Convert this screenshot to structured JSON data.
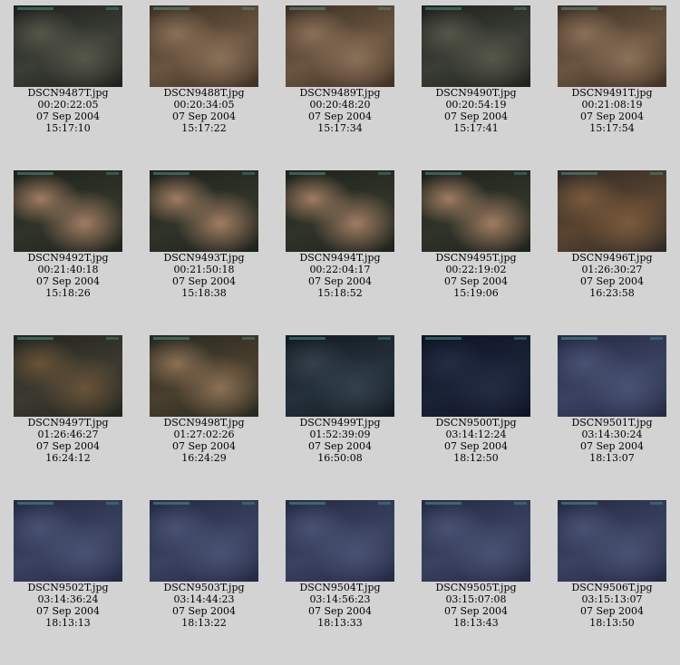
{
  "thumbnails": [
    {
      "file": "DSCN9487T.jpg",
      "timecode": "00:20:22:05",
      "date": "07 Sep 2004",
      "time": "15:17:10",
      "tone": "dark-rock"
    },
    {
      "file": "DSCN9488T.jpg",
      "timecode": "00:20:34:05",
      "date": "07 Sep 2004",
      "time": "15:17:22",
      "tone": "brown-rock"
    },
    {
      "file": "DSCN9489T.jpg",
      "timecode": "00:20:48:20",
      "date": "07 Sep 2004",
      "time": "15:17:34",
      "tone": "brown-rock"
    },
    {
      "file": "DSCN9490T.jpg",
      "timecode": "00:20:54:19",
      "date": "07 Sep 2004",
      "time": "15:17:41",
      "tone": "dark-rock"
    },
    {
      "file": "DSCN9491T.jpg",
      "timecode": "00:21:08:19",
      "date": "07 Sep 2004",
      "time": "15:17:54",
      "tone": "brown-rock"
    },
    {
      "file": "DSCN9492T.jpg",
      "timecode": "00:21:40:18",
      "date": "07 Sep 2004",
      "time": "15:18:26",
      "tone": "pillow"
    },
    {
      "file": "DSCN9493T.jpg",
      "timecode": "00:21:50:18",
      "date": "07 Sep 2004",
      "time": "15:18:38",
      "tone": "pillow"
    },
    {
      "file": "DSCN9494T.jpg",
      "timecode": "00:22:04:17",
      "date": "07 Sep 2004",
      "time": "15:18:52",
      "tone": "pillow"
    },
    {
      "file": "DSCN9495T.jpg",
      "timecode": "00:22:19:02",
      "date": "07 Sep 2004",
      "time": "15:19:06",
      "tone": "pillow"
    },
    {
      "file": "DSCN9496T.jpg",
      "timecode": "01:26:30:27",
      "date": "07 Sep 2004",
      "time": "16:23:58",
      "tone": "sediment"
    },
    {
      "file": "DSCN9497T.jpg",
      "timecode": "01:26:46:27",
      "date": "07 Sep 2004",
      "time": "16:24:12",
      "tone": "sediment-dark"
    },
    {
      "file": "DSCN9498T.jpg",
      "timecode": "01:27:02:26",
      "date": "07 Sep 2004",
      "time": "16:24:29",
      "tone": "pillow-dark"
    },
    {
      "file": "DSCN9499T.jpg",
      "timecode": "01:52:39:09",
      "date": "07 Sep 2004",
      "time": "16:50:08",
      "tone": "blue-dark"
    },
    {
      "file": "DSCN9500T.jpg",
      "timecode": "03:14:12:24",
      "date": "07 Sep 2004",
      "time": "18:12:50",
      "tone": "navy"
    },
    {
      "file": "DSCN9501T.jpg",
      "timecode": "03:14:30:24",
      "date": "07 Sep 2004",
      "time": "18:13:07",
      "tone": "blue"
    },
    {
      "file": "DSCN9502T.jpg",
      "timecode": "03:14:36:24",
      "date": "07 Sep 2004",
      "time": "18:13:13",
      "tone": "blue"
    },
    {
      "file": "DSCN9503T.jpg",
      "timecode": "03:14:44:23",
      "date": "07 Sep 2004",
      "time": "18:13:22",
      "tone": "blue"
    },
    {
      "file": "DSCN9504T.jpg",
      "timecode": "03:14:56:23",
      "date": "07 Sep 2004",
      "time": "18:13:33",
      "tone": "blue"
    },
    {
      "file": "DSCN9505T.jpg",
      "timecode": "03:15:07:08",
      "date": "07 Sep 2004",
      "time": "18:13:43",
      "tone": "blue"
    },
    {
      "file": "DSCN9506T.jpg",
      "timecode": "03:15:13:07",
      "date": "07 Sep 2004",
      "time": "18:13:50",
      "tone": "blue"
    }
  ],
  "tone_colors": {
    "dark-rock": [
      "#3b3e36",
      "#1d201c",
      "#56574a"
    ],
    "brown-rock": [
      "#6a5540",
      "#3e3024",
      "#8a7058"
    ],
    "pillow": [
      "#2f3328",
      "#1e221c",
      "#a07c62"
    ],
    "sediment": [
      "#5a4430",
      "#2e2a26",
      "#7a5a3c"
    ],
    "sediment-dark": [
      "#3c3a30",
      "#22241f",
      "#6a5338"
    ],
    "pillow-dark": [
      "#4a3f2e",
      "#262820",
      "#8c7054"
    ],
    "blue-dark": [
      "#24303a",
      "#121a22",
      "#34404a"
    ],
    "navy": [
      "#1a2236",
      "#0e1424",
      "#242c44"
    ],
    "blue": [
      "#3a4260",
      "#242a44",
      "#4a5274"
    ]
  },
  "page_background": "#d3d3d3"
}
